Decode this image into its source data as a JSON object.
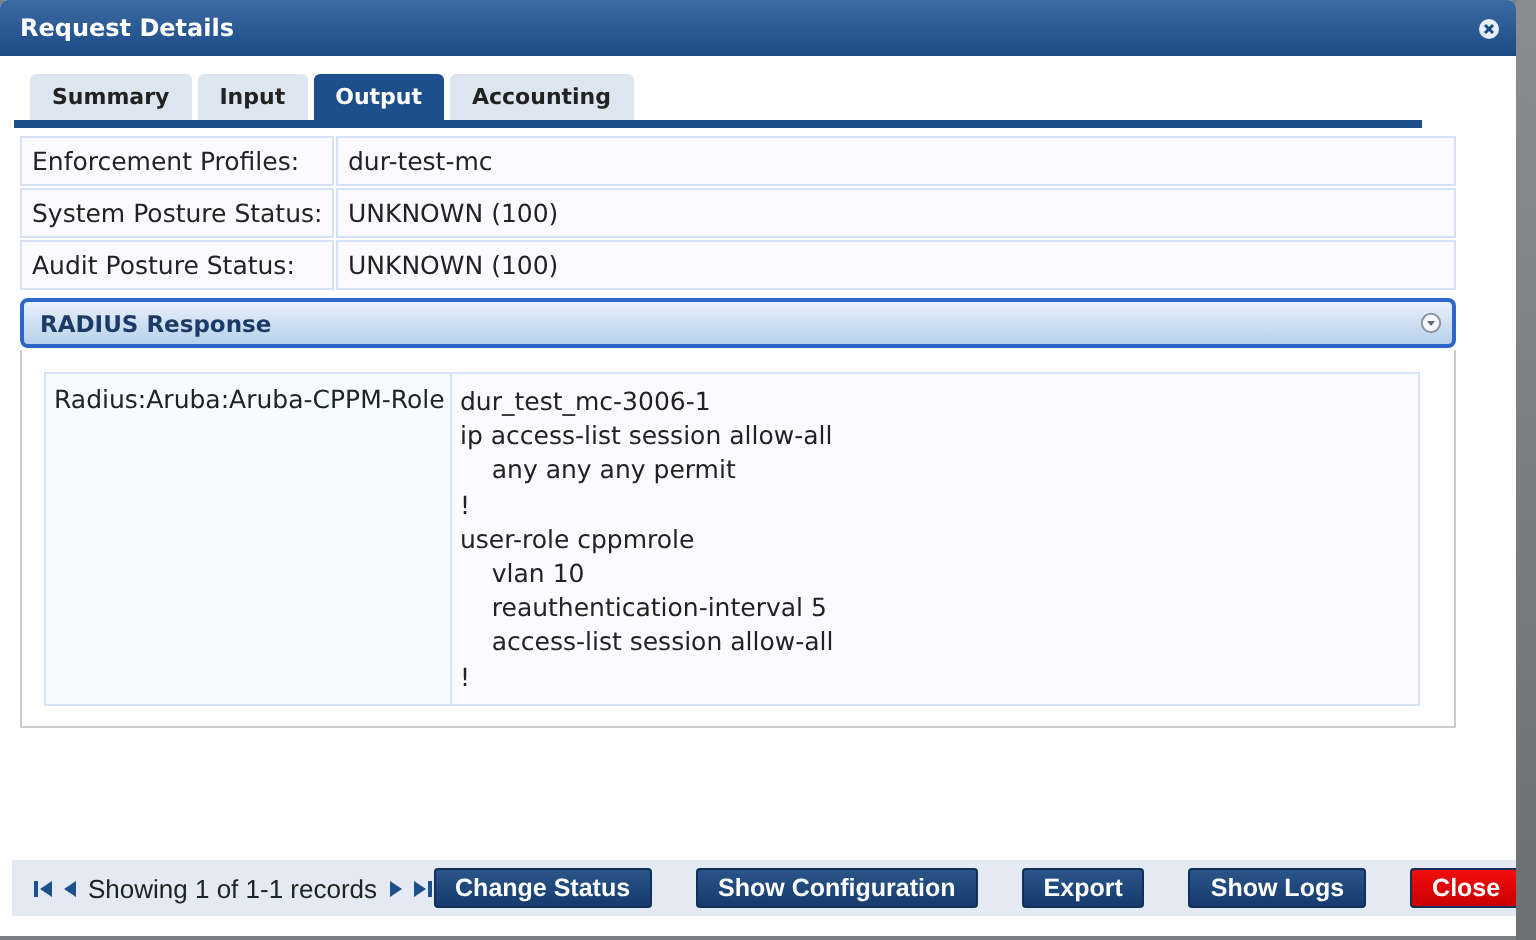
{
  "window": {
    "title": "Request Details"
  },
  "tabs": [
    {
      "label": "Summary",
      "selected": false
    },
    {
      "label": "Input",
      "selected": false
    },
    {
      "label": "Output",
      "selected": true
    },
    {
      "label": "Accounting",
      "selected": false
    }
  ],
  "fields": [
    {
      "label": "Enforcement Profiles:",
      "value": "dur-test-mc"
    },
    {
      "label": "System Posture Status:",
      "value": "UNKNOWN (100)"
    },
    {
      "label": "Audit Posture Status:",
      "value": "UNKNOWN (100)"
    }
  ],
  "radius_response": {
    "title": "RADIUS Response",
    "expanded": true,
    "attributes": [
      {
        "name": "Radius:Aruba:Aruba-CPPM-Role",
        "value_lines": [
          "dur_test_mc-3006-1",
          "ip access-list session allow-all",
          "    any any any permit",
          "!",
          "user-role cppmrole",
          "    vlan 10",
          "    reauthentication-interval 5",
          "    access-list session allow-all",
          "!"
        ]
      }
    ]
  },
  "pager": {
    "text": "Showing 1 of 1-1 records"
  },
  "buttons": [
    {
      "label": "Change Status",
      "kind": "normal"
    },
    {
      "label": "Show Configuration",
      "kind": "normal"
    },
    {
      "label": "Export",
      "kind": "normal"
    },
    {
      "label": "Show Logs",
      "kind": "normal"
    },
    {
      "label": "Close",
      "kind": "close"
    }
  ]
}
